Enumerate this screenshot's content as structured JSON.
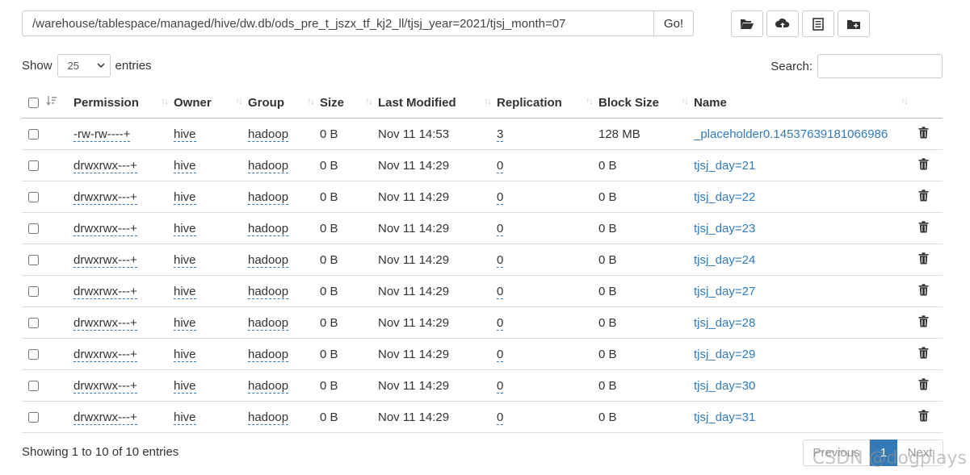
{
  "path_bar": {
    "value": "/warehouse/tablespace/managed/hive/dw.db/ods_pre_t_jszx_tf_kj2_ll/tjsj_year=2021/tjsj_month=07",
    "go_label": "Go!"
  },
  "toolbar": {
    "icons": [
      "folder-open-icon",
      "cloud-upload-icon",
      "list-icon",
      "folder-plus-icon"
    ]
  },
  "length_menu": {
    "prefix": "Show",
    "value": "25",
    "suffix": "entries"
  },
  "search": {
    "label": "Search:",
    "value": ""
  },
  "table": {
    "headers": {
      "permission": "Permission",
      "owner": "Owner",
      "group": "Group",
      "size": "Size",
      "last_modified": "Last Modified",
      "replication": "Replication",
      "block_size": "Block Size",
      "name": "Name"
    },
    "rows": [
      {
        "permission": "-rw-rw----+",
        "owner": "hive",
        "group": "hadoop",
        "size": "0 B",
        "modified": "Nov 11 14:53",
        "replication": "3",
        "block_size": "128 MB",
        "name": "_placeholder0.14537639181066986"
      },
      {
        "permission": "drwxrwx---+",
        "owner": "hive",
        "group": "hadoop",
        "size": "0 B",
        "modified": "Nov 11 14:29",
        "replication": "0",
        "block_size": "0 B",
        "name": "tjsj_day=21"
      },
      {
        "permission": "drwxrwx---+",
        "owner": "hive",
        "group": "hadoop",
        "size": "0 B",
        "modified": "Nov 11 14:29",
        "replication": "0",
        "block_size": "0 B",
        "name": "tjsj_day=22"
      },
      {
        "permission": "drwxrwx---+",
        "owner": "hive",
        "group": "hadoop",
        "size": "0 B",
        "modified": "Nov 11 14:29",
        "replication": "0",
        "block_size": "0 B",
        "name": "tjsj_day=23"
      },
      {
        "permission": "drwxrwx---+",
        "owner": "hive",
        "group": "hadoop",
        "size": "0 B",
        "modified": "Nov 11 14:29",
        "replication": "0",
        "block_size": "0 B",
        "name": "tjsj_day=24"
      },
      {
        "permission": "drwxrwx---+",
        "owner": "hive",
        "group": "hadoop",
        "size": "0 B",
        "modified": "Nov 11 14:29",
        "replication": "0",
        "block_size": "0 B",
        "name": "tjsj_day=27"
      },
      {
        "permission": "drwxrwx---+",
        "owner": "hive",
        "group": "hadoop",
        "size": "0 B",
        "modified": "Nov 11 14:29",
        "replication": "0",
        "block_size": "0 B",
        "name": "tjsj_day=28"
      },
      {
        "permission": "drwxrwx---+",
        "owner": "hive",
        "group": "hadoop",
        "size": "0 B",
        "modified": "Nov 11 14:29",
        "replication": "0",
        "block_size": "0 B",
        "name": "tjsj_day=29"
      },
      {
        "permission": "drwxrwx---+",
        "owner": "hive",
        "group": "hadoop",
        "size": "0 B",
        "modified": "Nov 11 14:29",
        "replication": "0",
        "block_size": "0 B",
        "name": "tjsj_day=30"
      },
      {
        "permission": "drwxrwx---+",
        "owner": "hive",
        "group": "hadoop",
        "size": "0 B",
        "modified": "Nov 11 14:29",
        "replication": "0",
        "block_size": "0 B",
        "name": "tjsj_day=31"
      }
    ]
  },
  "summary": "Showing 1 to 10 of 10 entries",
  "pagination": {
    "previous": "Previous",
    "current": "1",
    "next": "Next"
  },
  "watermark": "CSDN @dogplays",
  "colors": {
    "link": "#337ab7",
    "active_page": "#337ab7",
    "border": "#dddddd"
  }
}
